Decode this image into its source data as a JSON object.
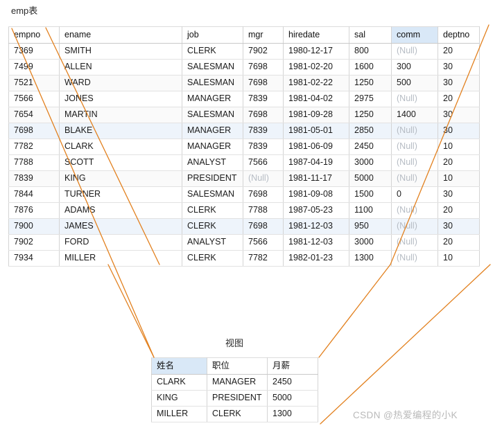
{
  "emp_section": {
    "title": "emp表",
    "columns": [
      "empno",
      "ename",
      "job",
      "mgr",
      "hiredate",
      "sal",
      "comm",
      "deptno"
    ],
    "highlighted_column": "comm",
    "null_text": "(Null)",
    "rows": [
      {
        "empno": "7369",
        "ename": "SMITH",
        "job": "CLERK",
        "mgr": "7902",
        "hiredate": "1980-12-17",
        "sal": "800",
        "comm": "(Null)",
        "deptno": "20",
        "style": "normal"
      },
      {
        "empno": "7499",
        "ename": "ALLEN",
        "job": "SALESMAN",
        "mgr": "7698",
        "hiredate": "1981-02-20",
        "sal": "1600",
        "comm": "300",
        "deptno": "30",
        "style": "normal"
      },
      {
        "empno": "7521",
        "ename": "WARD",
        "job": "SALESMAN",
        "mgr": "7698",
        "hiredate": "1981-02-22",
        "sal": "1250",
        "comm": "500",
        "deptno": "30",
        "style": "alt"
      },
      {
        "empno": "7566",
        "ename": "JONES",
        "job": "MANAGER",
        "mgr": "7839",
        "hiredate": "1981-04-02",
        "sal": "2975",
        "comm": "(Null)",
        "deptno": "20",
        "style": "normal"
      },
      {
        "empno": "7654",
        "ename": "MARTIN",
        "job": "SALESMAN",
        "mgr": "7698",
        "hiredate": "1981-09-28",
        "sal": "1250",
        "comm": "1400",
        "deptno": "30",
        "style": "alt"
      },
      {
        "empno": "7698",
        "ename": "BLAKE",
        "job": "MANAGER",
        "mgr": "7839",
        "hiredate": "1981-05-01",
        "sal": "2850",
        "comm": "(Null)",
        "deptno": "30",
        "style": "sel"
      },
      {
        "empno": "7782",
        "ename": "CLARK",
        "job": "MANAGER",
        "mgr": "7839",
        "hiredate": "1981-06-09",
        "sal": "2450",
        "comm": "(Null)",
        "deptno": "10",
        "style": "normal"
      },
      {
        "empno": "7788",
        "ename": "SCOTT",
        "job": "ANALYST",
        "mgr": "7566",
        "hiredate": "1987-04-19",
        "sal": "3000",
        "comm": "(Null)",
        "deptno": "20",
        "style": "normal"
      },
      {
        "empno": "7839",
        "ename": "KING",
        "job": "PRESIDENT",
        "mgr": "(Null)",
        "hiredate": "1981-11-17",
        "sal": "5000",
        "comm": "(Null)",
        "deptno": "10",
        "style": "alt"
      },
      {
        "empno": "7844",
        "ename": "TURNER",
        "job": "SALESMAN",
        "mgr": "7698",
        "hiredate": "1981-09-08",
        "sal": "1500",
        "comm": "0",
        "deptno": "30",
        "style": "normal"
      },
      {
        "empno": "7876",
        "ename": "ADAMS",
        "job": "CLERK",
        "mgr": "7788",
        "hiredate": "1987-05-23",
        "sal": "1100",
        "comm": "(Null)",
        "deptno": "20",
        "style": "normal"
      },
      {
        "empno": "7900",
        "ename": "JAMES",
        "job": "CLERK",
        "mgr": "7698",
        "hiredate": "1981-12-03",
        "sal": "950",
        "comm": "(Null)",
        "deptno": "30",
        "style": "sel"
      },
      {
        "empno": "7902",
        "ename": "FORD",
        "job": "ANALYST",
        "mgr": "7566",
        "hiredate": "1981-12-03",
        "sal": "3000",
        "comm": "(Null)",
        "deptno": "20",
        "style": "normal"
      },
      {
        "empno": "7934",
        "ename": "MILLER",
        "job": "CLERK",
        "mgr": "7782",
        "hiredate": "1982-01-23",
        "sal": "1300",
        "comm": "(Null)",
        "deptno": "10",
        "style": "normal"
      }
    ]
  },
  "view_section": {
    "title": "视图",
    "columns": [
      "姓名",
      "职位",
      "月薪"
    ],
    "highlighted_column": "姓名",
    "rows": [
      {
        "name": "CLARK",
        "job": "MANAGER",
        "sal": "2450"
      },
      {
        "name": "KING",
        "job": "PRESIDENT",
        "sal": "5000"
      },
      {
        "name": "MILLER",
        "job": "CLERK",
        "sal": "1300"
      }
    ]
  },
  "annotations": {
    "line_color": "#E2801E",
    "description": "orange leader lines connecting emp table rows to the view table"
  },
  "watermark": {
    "text": "CSDN @热爱编程的小K",
    "color": "#b9b9b9"
  }
}
